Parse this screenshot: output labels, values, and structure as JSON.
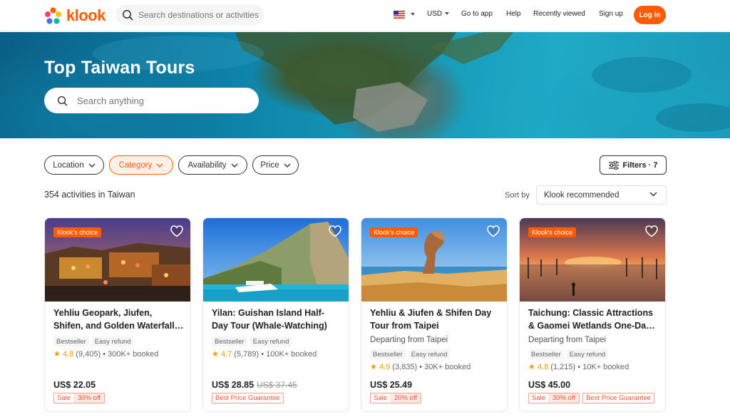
{
  "header": {
    "logo_text": "klook",
    "search_placeholder": "Search destinations or activities",
    "currency": "USD",
    "go_to_app": "Go to app",
    "help": "Help",
    "recently_viewed": "Recently viewed",
    "sign_up": "Sign up",
    "log_in": "Log in"
  },
  "hero": {
    "title": "Top Taiwan Tours",
    "search_placeholder": "Search anything"
  },
  "filters": {
    "location": "Location",
    "category": "Category",
    "availability": "Availability",
    "price": "Price",
    "filters_label": "Filters · 7"
  },
  "results": {
    "count": "354 activities in Taiwan",
    "sort_by": "Sort by",
    "sort_value": "Klook recommended"
  },
  "colors": {
    "brand": "#ff5b00",
    "star": "#f09b0a",
    "promo": "#e5543a"
  },
  "cards": [
    {
      "badge": "Klook's choice",
      "title_line1": "Yehliu Geopark, Jiufen,",
      "title_line2": "Shifen, and Golden Waterfall Tour",
      "departing": "",
      "tag1": "Bestseller",
      "tag2": "Easy refund",
      "star": "★",
      "score": "4.8",
      "reviews": "(9,405)",
      "booked": "• 300K+ booked",
      "price": "US$ 22.05",
      "old_price": "",
      "promo_sale": "Sale",
      "promo_off": "30% off",
      "promo_extra": ""
    },
    {
      "badge": "",
      "title_line1": "Yilan: Guishan Island Half-",
      "title_line2": "Day Tour (Whale-Watching)",
      "departing": "",
      "tag1": "Bestseller",
      "tag2": "Easy refund",
      "star": "★",
      "score": "4.7",
      "reviews": "(5,789)",
      "booked": "• 100K+ booked",
      "price": "US$ 28.85",
      "old_price": "US$ 37.45",
      "promo_sale": "",
      "promo_off": "",
      "promo_extra": "Best Price Guarantee"
    },
    {
      "badge": "Klook's choice",
      "title_line1": "Yehliu & Jiufen & Shifen Day",
      "title_line2": "Tour from Taipei",
      "departing": "Departing from Taipei",
      "tag1": "Bestseller",
      "tag2": "Easy refund",
      "star": "★",
      "score": "4.9",
      "reviews": "(3,835)",
      "booked": "• 30K+ booked",
      "price": "US$ 25.49",
      "old_price": "",
      "promo_sale": "Sale",
      "promo_off": "20% off",
      "promo_extra": ""
    },
    {
      "badge": "Klook's choice",
      "title_line1": "Taichung: Classic Attractions",
      "title_line2": "& Gaomei Wetlands One-Day Tour",
      "departing": "Departing from Taipei",
      "tag1": "Bestseller",
      "tag2": "Easy refund",
      "star": "★",
      "score": "4.8",
      "reviews": "(1,215)",
      "booked": "• 10K+ booked",
      "price": "US$ 45.00",
      "old_price": "",
      "promo_sale": "Sale",
      "promo_off": "30% off",
      "promo_extra": "Best Price Guarantee"
    }
  ]
}
